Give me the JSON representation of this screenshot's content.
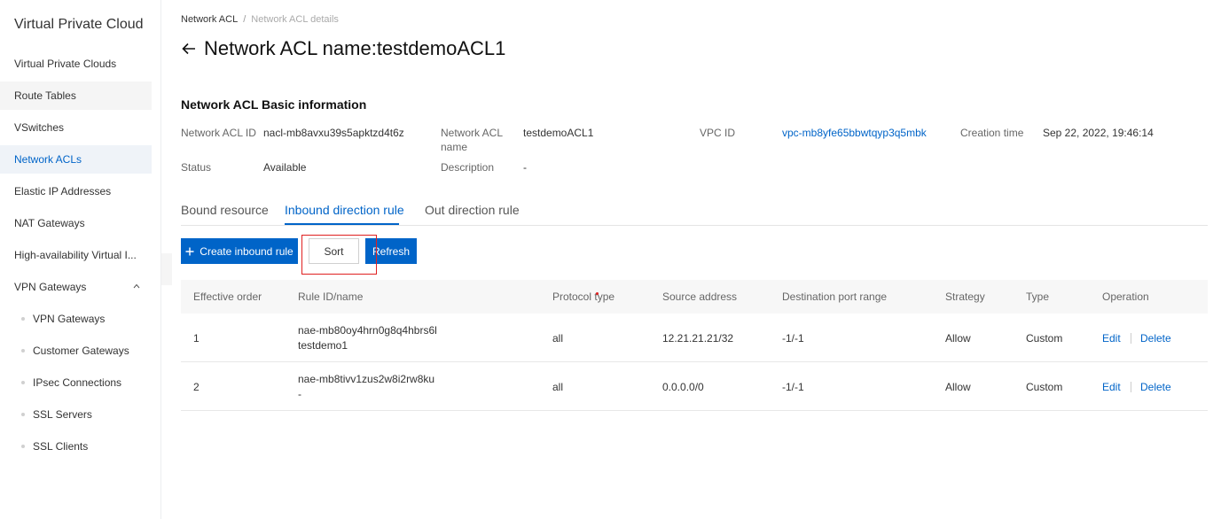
{
  "sidebar": {
    "title": "Virtual Private Cloud",
    "items": [
      {
        "label": "Virtual Private Clouds"
      },
      {
        "label": "Route Tables"
      },
      {
        "label": "VSwitches"
      },
      {
        "label": "Network ACLs"
      },
      {
        "label": "Elastic IP Addresses"
      },
      {
        "label": "NAT Gateways"
      },
      {
        "label": "High-availability Virtual I..."
      },
      {
        "label": "VPN Gateways"
      }
    ],
    "sub_items": [
      {
        "label": "VPN Gateways"
      },
      {
        "label": "Customer Gateways"
      },
      {
        "label": "IPsec Connections"
      },
      {
        "label": "SSL Servers"
      },
      {
        "label": "SSL Clients"
      }
    ],
    "active_item": "Network ACLs",
    "accent_color": "#0064c8"
  },
  "breadcrumb": {
    "parent": "Network ACL",
    "separator": "/",
    "current": "Network ACL details"
  },
  "page": {
    "title": "Network ACL name:testdemoACL1",
    "back_icon": "arrow-left-icon"
  },
  "basic_info": {
    "section_title": "Network ACL Basic information",
    "acl_id_label": "Network ACL ID",
    "acl_id_value": "nacl-mb8avxu39s5apktzd4t6z",
    "acl_name_label_1": "Network ACL",
    "acl_name_label_2": "name",
    "acl_name_value": "testdemoACL1",
    "vpc_id_label": "VPC ID",
    "vpc_id_value": "vpc-mb8yfe65bbwtqyp3q5mbk",
    "creation_time_label": "Creation time",
    "creation_time_value": "Sep 22, 2022, 19:46:14",
    "status_label": "Status",
    "status_value": "Available",
    "description_label": "Description",
    "description_value": "-"
  },
  "tabs": [
    {
      "label": "Bound resource"
    },
    {
      "label": "Inbound direction rule"
    },
    {
      "label": "Out direction rule"
    }
  ],
  "active_tab": "Inbound direction rule",
  "toolbar": {
    "create_label": "Create inbound rule",
    "sort_label": "Sort",
    "refresh_label": "Refresh"
  },
  "table": {
    "headers": {
      "order": "Effective order",
      "rule": "Rule ID/name",
      "protocol": "Protocol type",
      "source": "Source address",
      "port": "Destination port range",
      "strategy": "Strategy",
      "type": "Type",
      "operation": "Operation"
    },
    "rows": [
      {
        "order": "1",
        "rule_id": "nae-mb80oy4hrn0g8q4hbrs6l",
        "rule_name": "testdemo1",
        "protocol": "all",
        "source": "12.21.21.21/32",
        "port": "-1/-1",
        "strategy": "Allow",
        "type": "Custom",
        "edit": "Edit",
        "delete": "Delete"
      },
      {
        "order": "2",
        "rule_id": "nae-mb8tivv1zus2w8i2rw8ku",
        "rule_name": "-",
        "protocol": "all",
        "source": "0.0.0.0/0",
        "port": "-1/-1",
        "strategy": "Allow",
        "type": "Custom",
        "edit": "Edit",
        "delete": "Delete"
      }
    ]
  },
  "highlight_color": "#e02020"
}
